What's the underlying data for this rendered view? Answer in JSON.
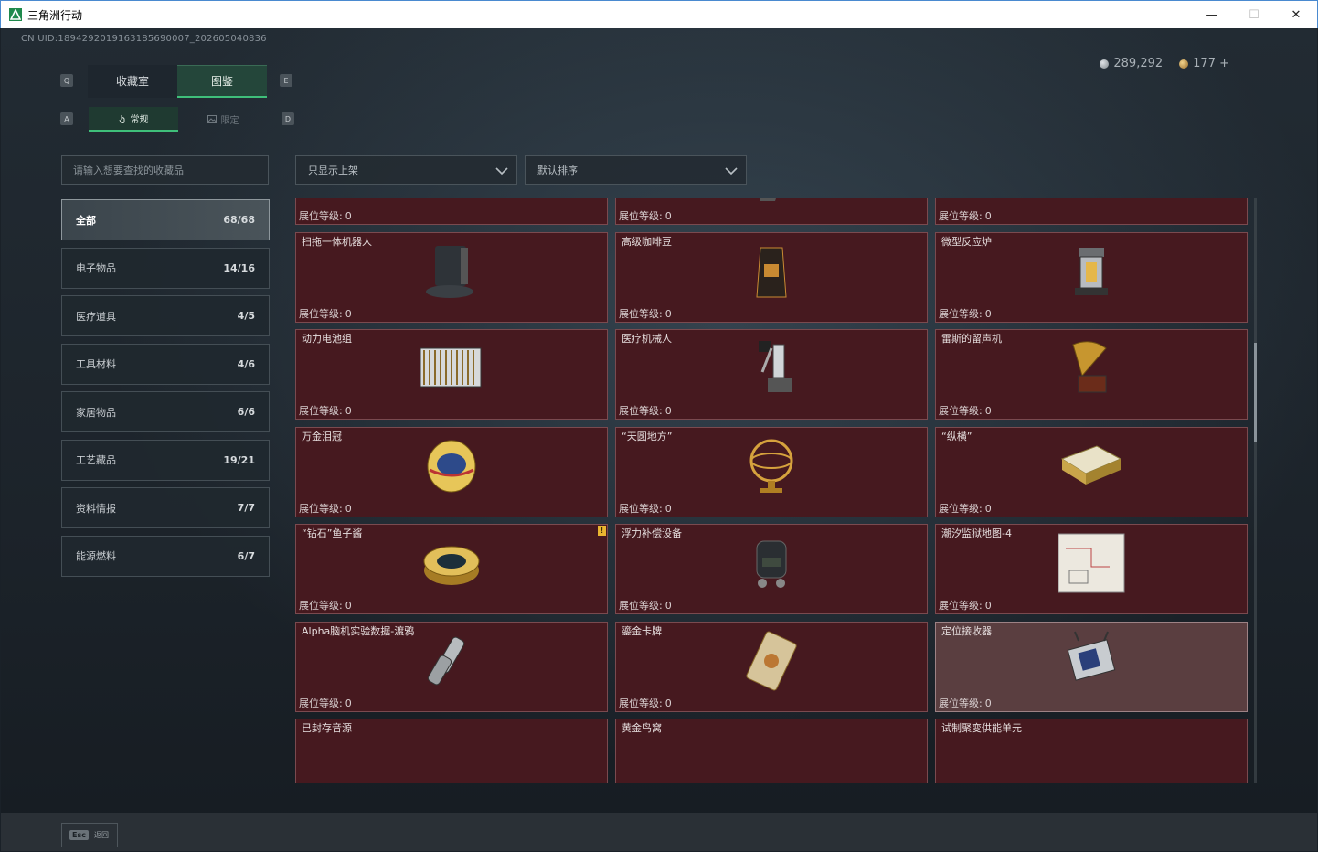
{
  "window": {
    "title": "三角洲行动",
    "minimize": "—",
    "maximize": "☐",
    "close": "✕"
  },
  "header": {
    "uid": "CN UID:1894292019163185690007_202605040836",
    "currency": [
      {
        "icon": "silver-coin-icon",
        "value": "289,292"
      },
      {
        "icon": "gold-coin-icon",
        "value": "177 +"
      }
    ]
  },
  "keys": {
    "q": "Q",
    "e": "E",
    "a": "A",
    "d": "D"
  },
  "tabs": [
    {
      "label": "收藏室",
      "active": false
    },
    {
      "label": "图鉴",
      "active": true
    }
  ],
  "subtabs": [
    {
      "label": "常规",
      "icon": "hand-icon",
      "active": true
    },
    {
      "label": "限定",
      "icon": "image-icon",
      "active": false
    }
  ],
  "search": {
    "placeholder": "请输入想要查找的收藏品"
  },
  "filters": {
    "show": "只显示上架",
    "sort": "默认排序"
  },
  "categories": [
    {
      "label": "全部",
      "count": "68/68",
      "active": true
    },
    {
      "label": "电子物品",
      "count": "14/16"
    },
    {
      "label": "医疗道具",
      "count": "4/5"
    },
    {
      "label": "工具材料",
      "count": "4/6"
    },
    {
      "label": "家居物品",
      "count": "6/6"
    },
    {
      "label": "工艺藏品",
      "count": "19/21"
    },
    {
      "label": "资料情报",
      "count": "7/7"
    },
    {
      "label": "能源燃料",
      "count": "6/7"
    }
  ],
  "level_label": "展位等级:",
  "items": [
    {
      "name": "",
      "level": "0",
      "icon": "medical-console-icon"
    },
    {
      "name": "",
      "level": "0",
      "icon": "vacuum-cleaner-icon"
    },
    {
      "name": "",
      "level": "0",
      "icon": "camera-module-icon"
    },
    {
      "name": "扫拖一体机器人",
      "level": "0",
      "icon": "robot-vacuum-icon"
    },
    {
      "name": "高级咖啡豆",
      "level": "0",
      "icon": "coffee-bag-icon"
    },
    {
      "name": "微型反应炉",
      "level": "0",
      "icon": "reactor-icon"
    },
    {
      "name": "动力电池组",
      "level": "0",
      "icon": "battery-pack-icon"
    },
    {
      "name": "医疗机械人",
      "level": "0",
      "icon": "medical-robot-icon"
    },
    {
      "name": "雷斯的留声机",
      "level": "0",
      "icon": "gramophone-icon"
    },
    {
      "name": "万金泪冠",
      "level": "0",
      "icon": "jeweled-egg-icon"
    },
    {
      "name": "“天圆地方”",
      "level": "0",
      "icon": "armillary-sphere-icon"
    },
    {
      "name": "“纵横”",
      "level": "0",
      "icon": "chess-box-icon"
    },
    {
      "name": "“钻石”鱼子酱",
      "level": "0",
      "icon": "caviar-tin-icon",
      "badge": "!"
    },
    {
      "name": "浮力补偿设备",
      "level": "0",
      "icon": "diving-gear-icon"
    },
    {
      "name": "潮汐监狱地图-4",
      "level": "0",
      "icon": "map-icon"
    },
    {
      "name": "Alpha脑机实验数据-渡鸦",
      "level": "0",
      "icon": "data-canister-icon"
    },
    {
      "name": "鎏金卡牌",
      "level": "0",
      "icon": "gilded-card-icon"
    },
    {
      "name": "定位接收器",
      "level": "0",
      "icon": "gps-receiver-icon",
      "highlight": true
    },
    {
      "name": "已封存音源",
      "level": "",
      "icon": ""
    },
    {
      "name": "黄金鸟窝",
      "level": "",
      "icon": ""
    },
    {
      "name": "试制聚变供能单元",
      "level": "",
      "icon": ""
    }
  ],
  "footer": {
    "esc_key": "Esc",
    "esc_label": "返回"
  }
}
